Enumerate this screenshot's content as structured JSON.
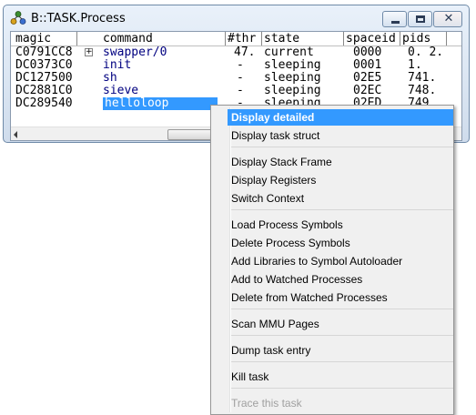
{
  "window": {
    "title": "B::TASK.Process"
  },
  "table": {
    "columns": [
      "magic",
      "command",
      "#thr",
      "state",
      "spaceid",
      "pids"
    ],
    "rows": [
      {
        "magic": "C0791CC8",
        "command": "swapper/0",
        "thr": "47.",
        "state": "current",
        "spaceid": "0000",
        "pids": "0. 2.",
        "expandable": true
      },
      {
        "magic": "DC0373C0",
        "command": "init",
        "thr": "-",
        "state": "sleeping",
        "spaceid": "0001",
        "pids": "1."
      },
      {
        "magic": "DC127500",
        "command": "sh",
        "thr": "-",
        "state": "sleeping",
        "spaceid": "02E5",
        "pids": "741."
      },
      {
        "magic": "DC2881C0",
        "command": "sieve",
        "thr": "-",
        "state": "sleeping",
        "spaceid": "02EC",
        "pids": "748."
      },
      {
        "magic": "DC289540",
        "command": "helloloop",
        "thr": "-",
        "state": "sleeping",
        "spaceid": "02ED",
        "pids": "749",
        "selected": true
      }
    ]
  },
  "menu": {
    "groups": [
      [
        {
          "label": "Display detailed",
          "highlighted": true
        },
        {
          "label": "Display task struct"
        }
      ],
      [
        {
          "label": "Display Stack Frame"
        },
        {
          "label": "Display Registers"
        },
        {
          "label": "Switch Context"
        }
      ],
      [
        {
          "label": "Load Process Symbols"
        },
        {
          "label": "Delete Process Symbols"
        },
        {
          "label": "Add Libraries to Symbol Autoloader"
        },
        {
          "label": "Add to Watched Processes"
        },
        {
          "label": "Delete from Watched Processes"
        }
      ],
      [
        {
          "label": "Scan MMU Pages"
        }
      ],
      [
        {
          "label": "Dump task entry"
        }
      ],
      [
        {
          "label": "Kill task"
        }
      ],
      [
        {
          "label": "Trace this task",
          "disabled": true
        }
      ]
    ]
  },
  "colors": {
    "selection": "#3399ff",
    "link": "#000080"
  }
}
